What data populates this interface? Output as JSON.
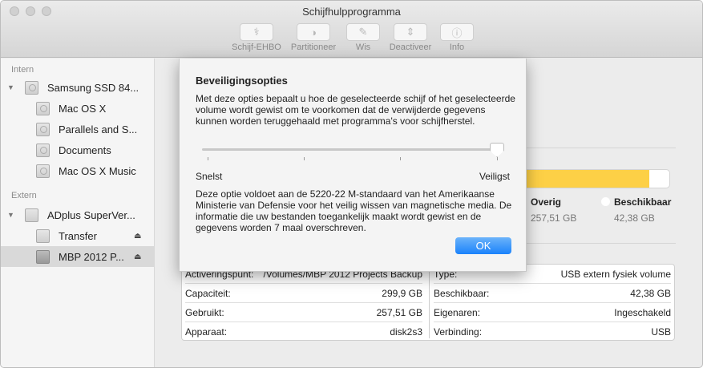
{
  "window": {
    "title": "Schijfhulpprogramma"
  },
  "toolbar": [
    {
      "label": "Schijf-EHBO",
      "icon": "stethoscope-icon",
      "glyph": "⚕"
    },
    {
      "label": "Partitioneer",
      "icon": "partition-icon",
      "glyph": "◑"
    },
    {
      "label": "Wis",
      "icon": "erase-icon",
      "glyph": "✎"
    },
    {
      "label": "Deactiveer",
      "icon": "unmount-icon",
      "glyph": "⇕"
    },
    {
      "label": "Info",
      "icon": "info-icon",
      "glyph": "ⓘ"
    }
  ],
  "sidebar": {
    "internal_label": "Intern",
    "external_label": "Extern",
    "items": [
      {
        "label": "Samsung SSD 84..."
      },
      {
        "label": "Mac OS X"
      },
      {
        "label": "Parallels and S..."
      },
      {
        "label": "Documents"
      },
      {
        "label": "Mac OS X Music"
      },
      {
        "label": "ADplus SuperVer..."
      },
      {
        "label": "Transfer"
      },
      {
        "label": "MBP 2012 P..."
      }
    ]
  },
  "dialog": {
    "title": "Beveiligingsopties",
    "description": "Met deze opties bepaalt u hoe de geselecteerde schijf of het geselecteerde volume wordt gewist om te voorkomen dat de verwijderde gegevens kunnen worden teruggehaald met programma's voor schijfherstel.",
    "slider": {
      "min_label": "Snelst",
      "max_label": "Veiligst",
      "value": 3,
      "steps": 4
    },
    "explanation": "Deze optie voldoet aan de 5220-22 M-standaard van het Amerikaanse Ministerie van Defensie voor het veilig wissen van magnetische media. De informatie die uw bestanden toegankelijk maakt wordt gewist en de gegevens worden 7 maal overschreven.",
    "ok_label": "OK"
  },
  "usage": {
    "used_fraction": 0.8587,
    "color": "#fdd046",
    "other_label": "Overig",
    "other_value": "257,51 GB",
    "free_label": "Beschikbaar",
    "free_value": "42,38 GB"
  },
  "info": {
    "left": [
      {
        "k": "Activeringspunt:",
        "v": "/Volumes/MBP 2012 Projects Backup"
      },
      {
        "k": "Capaciteit:",
        "v": "299,9 GB"
      },
      {
        "k": "Gebruikt:",
        "v": "257,51 GB"
      },
      {
        "k": "Apparaat:",
        "v": "disk2s3"
      }
    ],
    "right": [
      {
        "k": "Type:",
        "v": "USB extern fysiek volume"
      },
      {
        "k": "Beschikbaar:",
        "v": "42,38 GB"
      },
      {
        "k": "Eigenaren:",
        "v": "Ingeschakeld"
      },
      {
        "k": "Verbinding:",
        "v": "USB"
      }
    ]
  }
}
